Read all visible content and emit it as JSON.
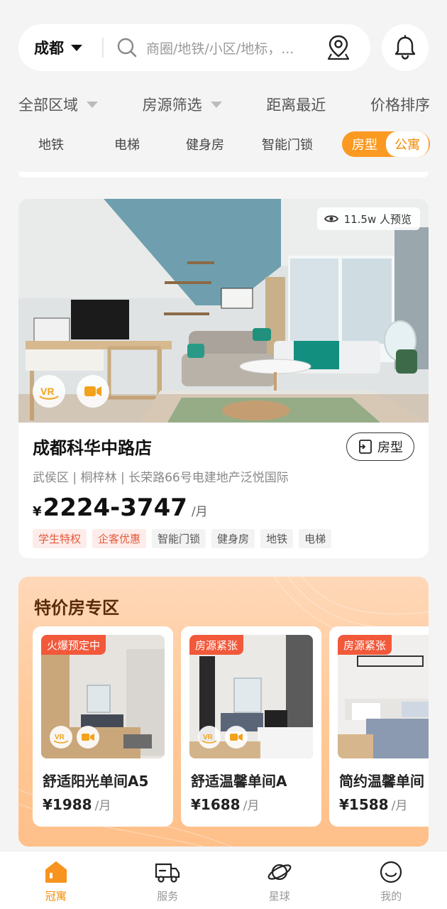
{
  "search": {
    "city": "成都",
    "placeholder": "商圈/地铁/小区/地标，..."
  },
  "filters": [
    {
      "label": "全部区域",
      "dropdown": true
    },
    {
      "label": "房源筛选",
      "dropdown": true
    },
    {
      "label": "距离最近",
      "dropdown": false
    },
    {
      "label": "价格排序",
      "dropdown": false
    }
  ],
  "tags": [
    "地铁",
    "电梯",
    "健身房",
    "智能门锁"
  ],
  "type_toggle": {
    "option_a": "房型",
    "option_b": "公寓",
    "selected": "公寓"
  },
  "listing": {
    "views": "11.5w 人预览",
    "title": "成都科华中路店",
    "layout_button": "房型",
    "address": "武侯区 | 桐梓林 | 长荣路66号电建地产泛悦国际",
    "currency": "¥",
    "price": "2224-3747",
    "unit": "/月",
    "chips": [
      {
        "text": "学生特权",
        "style": "red"
      },
      {
        "text": "企客优惠",
        "style": "red"
      },
      {
        "text": "智能门锁",
        "style": "gray"
      },
      {
        "text": "健身房",
        "style": "gray"
      },
      {
        "text": "地铁",
        "style": "gray"
      },
      {
        "text": "电梯",
        "style": "gray"
      }
    ]
  },
  "special": {
    "title": "特价房专区",
    "items": [
      {
        "badge": "火爆预定中",
        "name": "舒适阳光单间A5",
        "price": "¥1988",
        "unit": "/月"
      },
      {
        "badge": "房源紧张",
        "name": "舒适温馨单间A",
        "price": "¥1688",
        "unit": "/月"
      },
      {
        "badge": "房源紧张",
        "name": "简约温馨单间",
        "price": "¥1588",
        "unit": "/月"
      }
    ]
  },
  "nav": {
    "items": [
      {
        "label": "冠寓",
        "icon": "home-icon",
        "active": true
      },
      {
        "label": "服务",
        "icon": "truck-icon",
        "active": false
      },
      {
        "label": "星球",
        "icon": "planet-icon",
        "active": false
      },
      {
        "label": "我的",
        "icon": "smile-icon",
        "active": false
      }
    ]
  },
  "colors": {
    "accent": "#f28a00",
    "toggle_bg": "#fa9a23",
    "badge_red": "#f2583a",
    "chip_red_text": "#e55a3c",
    "special_bg": "#ffc896"
  }
}
